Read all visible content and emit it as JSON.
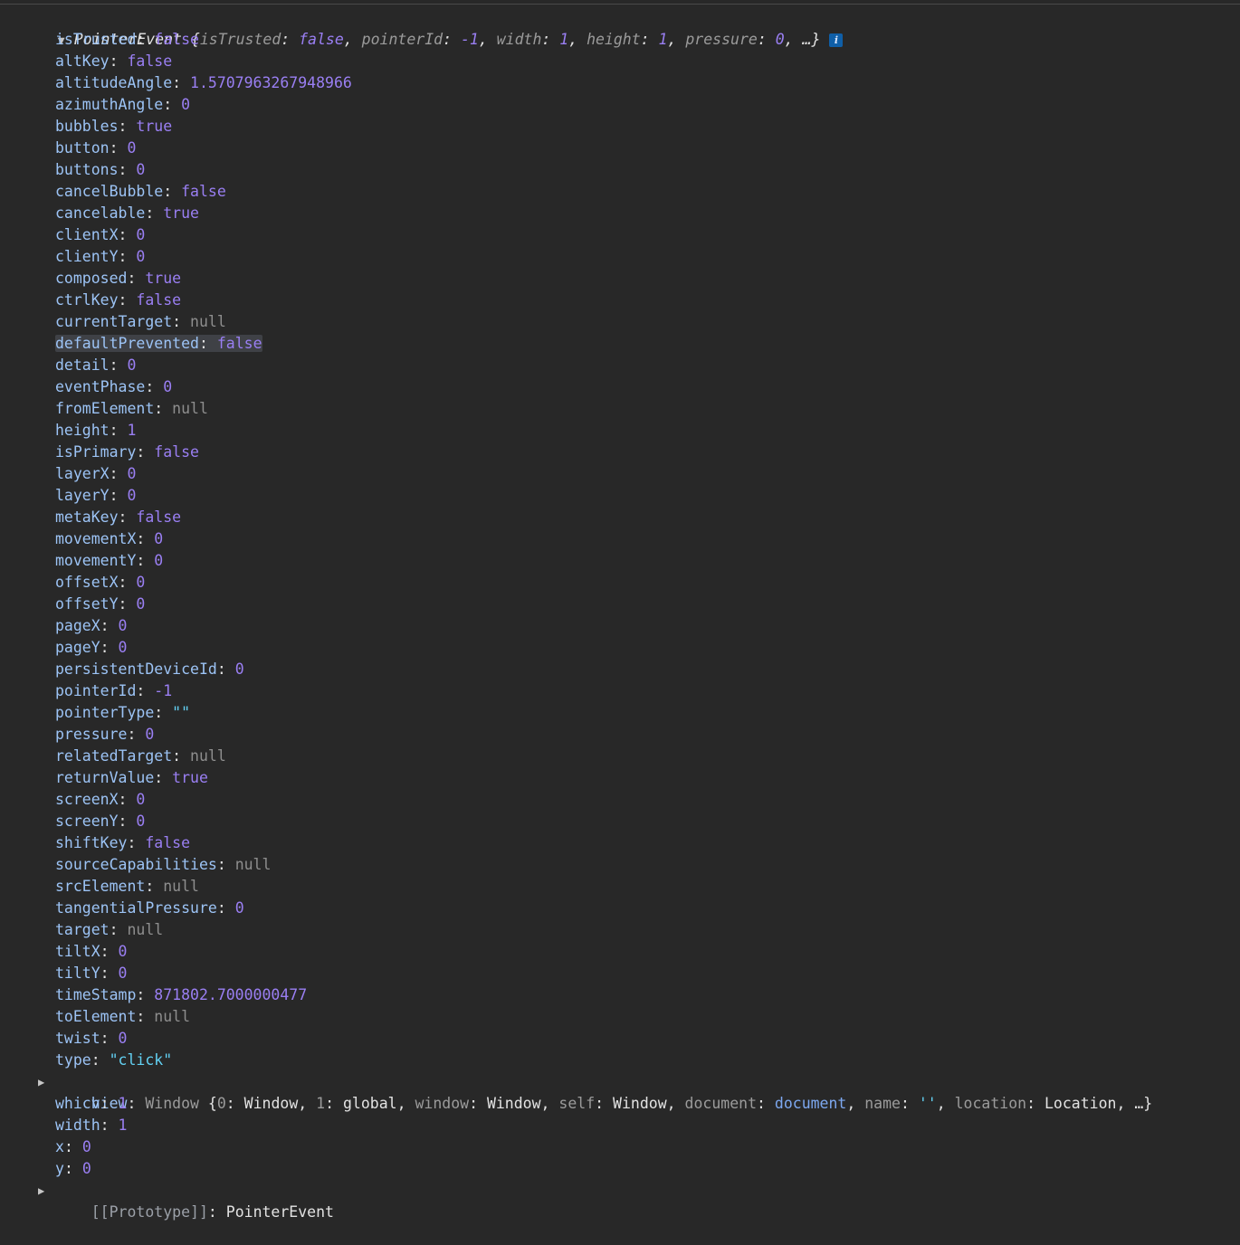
{
  "header": {
    "class_name": "PointerEvent",
    "preview": {
      "open": "{",
      "items": [
        {
          "k": "isTrusted",
          "v": "false",
          "t": "bool"
        },
        {
          "k": "pointerId",
          "v": "-1",
          "t": "num"
        },
        {
          "k": "width",
          "v": "1",
          "t": "num"
        },
        {
          "k": "height",
          "v": "1",
          "t": "num"
        },
        {
          "k": "pressure",
          "v": "0",
          "t": "num"
        }
      ],
      "tail": ", …}"
    },
    "info_icon": "i"
  },
  "properties": [
    {
      "k": "isTrusted",
      "v": "false",
      "t": "bool"
    },
    {
      "k": "altKey",
      "v": "false",
      "t": "bool"
    },
    {
      "k": "altitudeAngle",
      "v": "1.5707963267948966",
      "t": "num"
    },
    {
      "k": "azimuthAngle",
      "v": "0",
      "t": "num"
    },
    {
      "k": "bubbles",
      "v": "true",
      "t": "bool"
    },
    {
      "k": "button",
      "v": "0",
      "t": "num"
    },
    {
      "k": "buttons",
      "v": "0",
      "t": "num"
    },
    {
      "k": "cancelBubble",
      "v": "false",
      "t": "bool"
    },
    {
      "k": "cancelable",
      "v": "true",
      "t": "bool"
    },
    {
      "k": "clientX",
      "v": "0",
      "t": "num"
    },
    {
      "k": "clientY",
      "v": "0",
      "t": "num"
    },
    {
      "k": "composed",
      "v": "true",
      "t": "bool"
    },
    {
      "k": "ctrlKey",
      "v": "false",
      "t": "bool"
    },
    {
      "k": "currentTarget",
      "v": "null",
      "t": "nul"
    },
    {
      "k": "defaultPrevented",
      "v": "false",
      "t": "bool",
      "highlighted": true
    },
    {
      "k": "detail",
      "v": "0",
      "t": "num"
    },
    {
      "k": "eventPhase",
      "v": "0",
      "t": "num"
    },
    {
      "k": "fromElement",
      "v": "null",
      "t": "nul"
    },
    {
      "k": "height",
      "v": "1",
      "t": "num"
    },
    {
      "k": "isPrimary",
      "v": "false",
      "t": "bool"
    },
    {
      "k": "layerX",
      "v": "0",
      "t": "num"
    },
    {
      "k": "layerY",
      "v": "0",
      "t": "num"
    },
    {
      "k": "metaKey",
      "v": "false",
      "t": "bool"
    },
    {
      "k": "movementX",
      "v": "0",
      "t": "num"
    },
    {
      "k": "movementY",
      "v": "0",
      "t": "num"
    },
    {
      "k": "offsetX",
      "v": "0",
      "t": "num"
    },
    {
      "k": "offsetY",
      "v": "0",
      "t": "num"
    },
    {
      "k": "pageX",
      "v": "0",
      "t": "num"
    },
    {
      "k": "pageY",
      "v": "0",
      "t": "num"
    },
    {
      "k": "persistentDeviceId",
      "v": "0",
      "t": "num"
    },
    {
      "k": "pointerId",
      "v": "-1",
      "t": "num"
    },
    {
      "k": "pointerType",
      "v": "\"\"",
      "t": "str"
    },
    {
      "k": "pressure",
      "v": "0",
      "t": "num"
    },
    {
      "k": "relatedTarget",
      "v": "null",
      "t": "nul"
    },
    {
      "k": "returnValue",
      "v": "true",
      "t": "bool"
    },
    {
      "k": "screenX",
      "v": "0",
      "t": "num"
    },
    {
      "k": "screenY",
      "v": "0",
      "t": "num"
    },
    {
      "k": "shiftKey",
      "v": "false",
      "t": "bool"
    },
    {
      "k": "sourceCapabilities",
      "v": "null",
      "t": "nul"
    },
    {
      "k": "srcElement",
      "v": "null",
      "t": "nul"
    },
    {
      "k": "tangentialPressure",
      "v": "0",
      "t": "num"
    },
    {
      "k": "target",
      "v": "null",
      "t": "nul"
    },
    {
      "k": "tiltX",
      "v": "0",
      "t": "num"
    },
    {
      "k": "tiltY",
      "v": "0",
      "t": "num"
    },
    {
      "k": "timeStamp",
      "v": "871802.7000000477",
      "t": "num"
    },
    {
      "k": "toElement",
      "v": "null",
      "t": "nul"
    },
    {
      "k": "twist",
      "v": "0",
      "t": "num"
    },
    {
      "k": "type",
      "v": "\"click\"",
      "t": "str"
    }
  ],
  "view": {
    "key": "view",
    "type": "Window",
    "preview": [
      {
        "k": "0",
        "v": "Window",
        "t": "obj"
      },
      {
        "k": "1",
        "v": "global",
        "t": "obj"
      },
      {
        "k": "window",
        "v": "Window",
        "t": "obj"
      },
      {
        "k": "self",
        "v": "Window",
        "t": "obj"
      },
      {
        "k": "document",
        "v": "document",
        "t": "doc"
      },
      {
        "k": "name",
        "v": "''",
        "t": "str"
      },
      {
        "k": "location",
        "v": "Location",
        "t": "obj"
      }
    ],
    "tail": ", …}"
  },
  "properties_after": [
    {
      "k": "which",
      "v": "1",
      "t": "num"
    },
    {
      "k": "width",
      "v": "1",
      "t": "num"
    },
    {
      "k": "x",
      "v": "0",
      "t": "num"
    },
    {
      "k": "y",
      "v": "0",
      "t": "num"
    }
  ],
  "prototype": {
    "key": "[[Prototype]]",
    "value": "PointerEvent"
  },
  "colors": {
    "background": "#282828",
    "key": "#9cc3f5",
    "number": "#9a7ff3",
    "null": "#8e8e8e",
    "string": "#62d0f2"
  }
}
